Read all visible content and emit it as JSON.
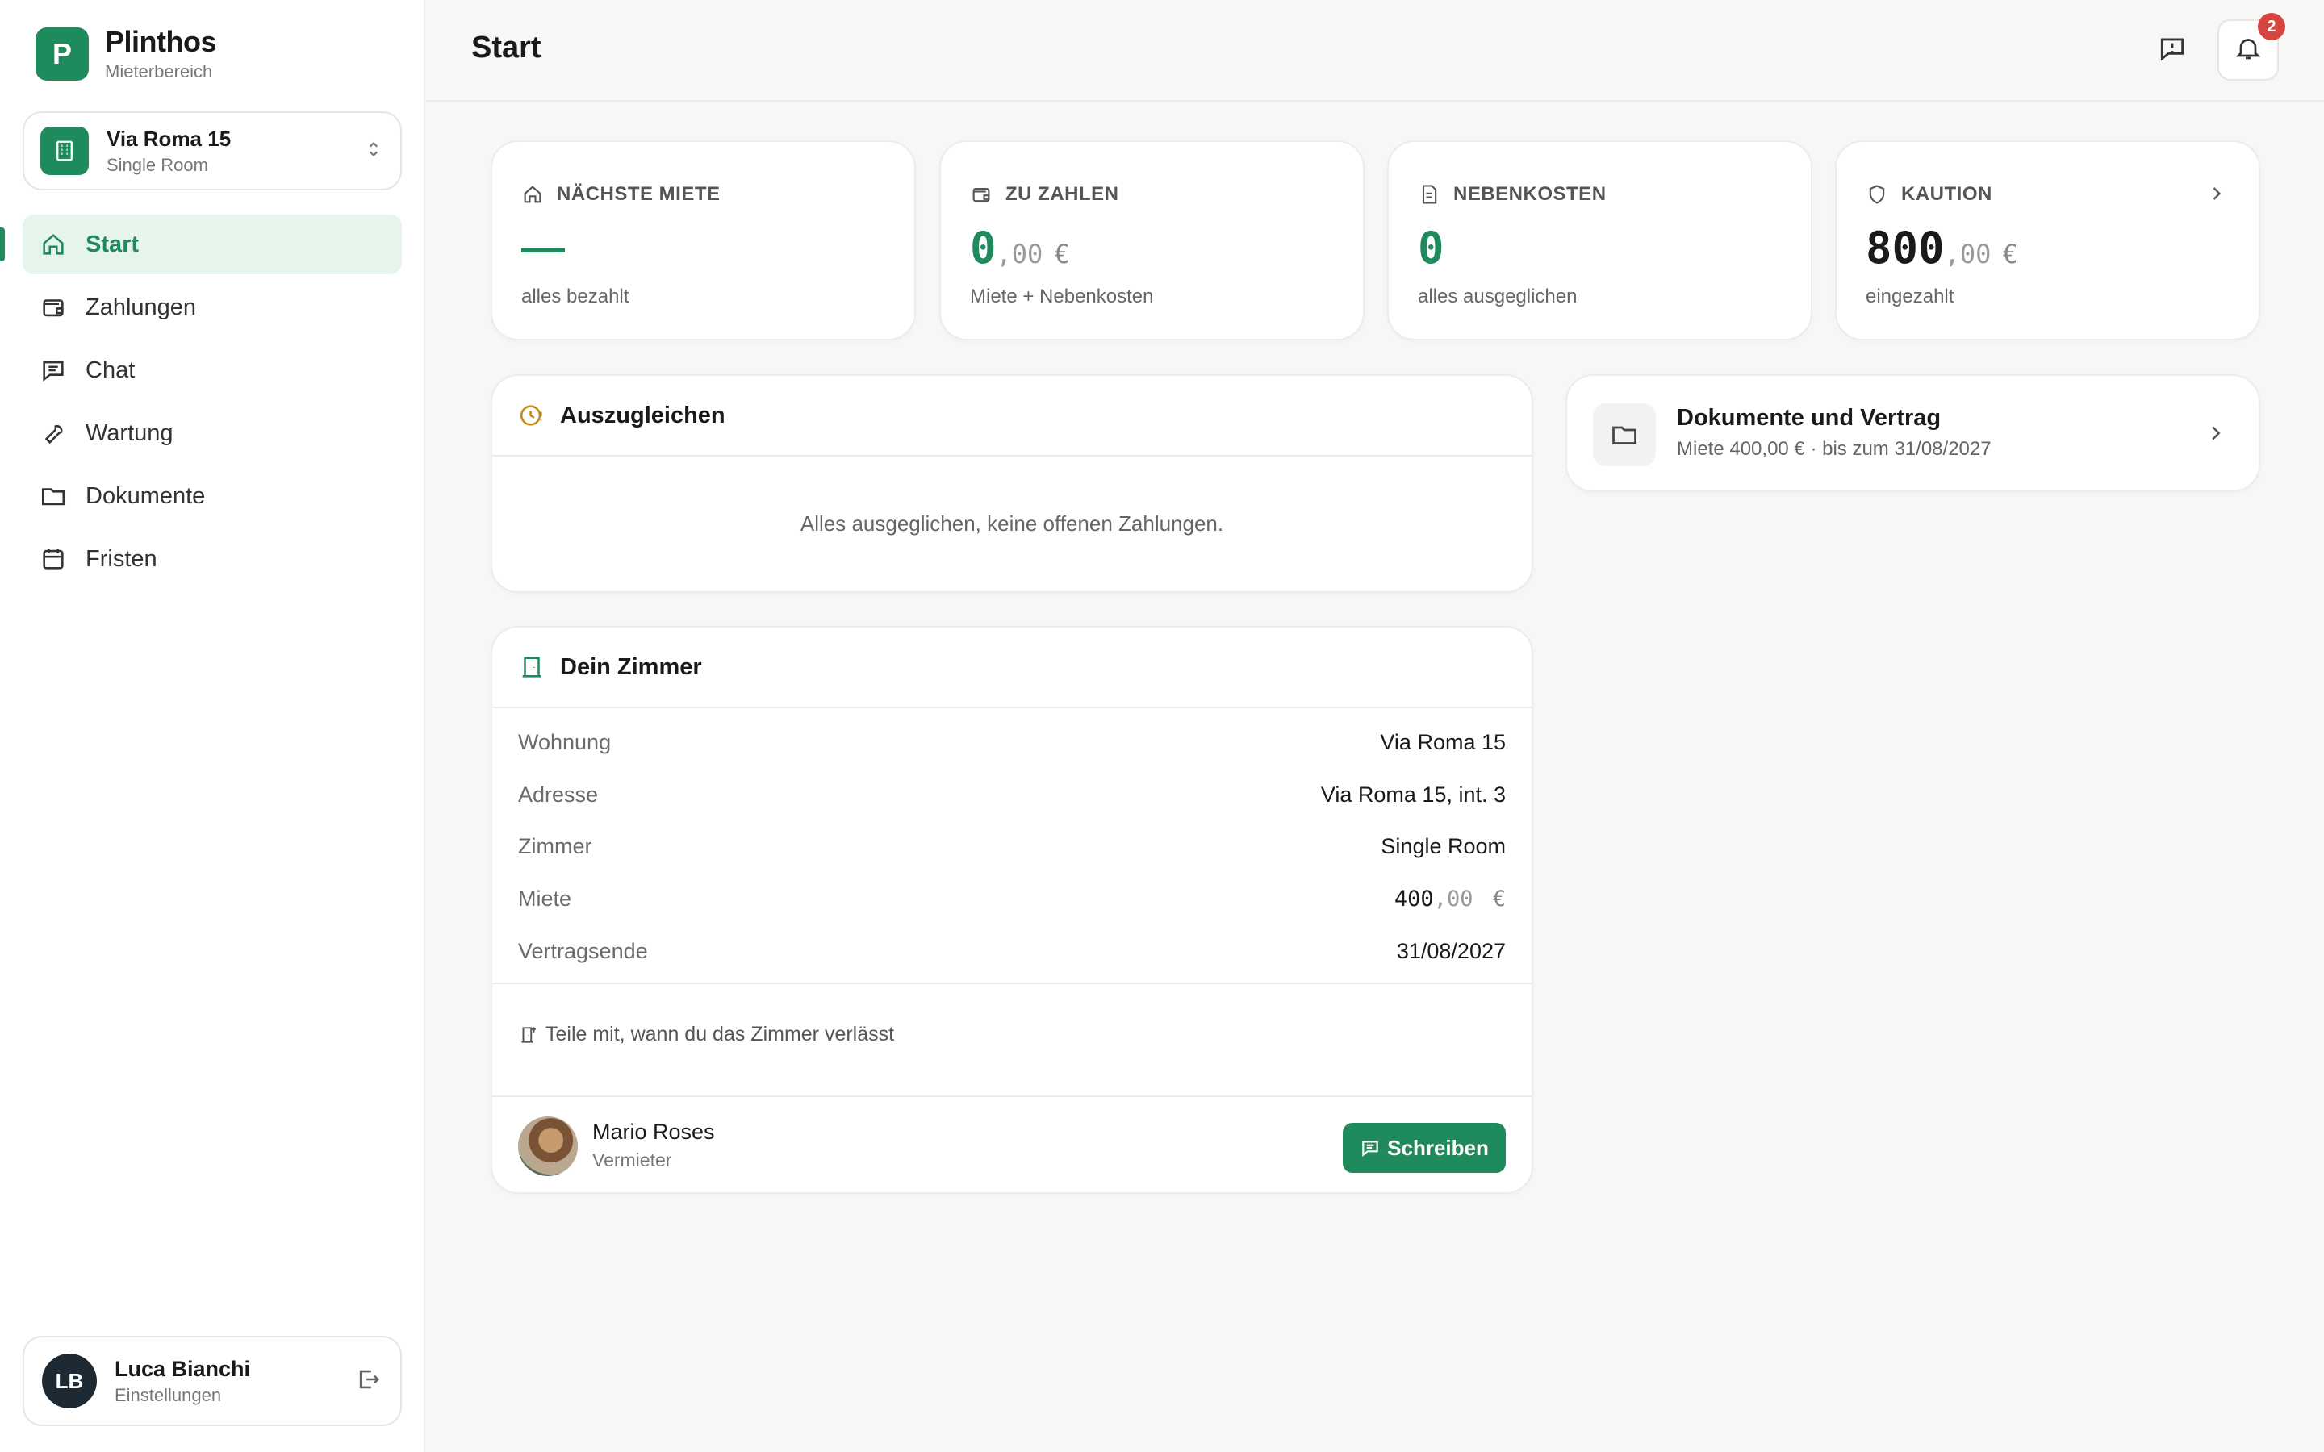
{
  "brand": {
    "initial": "P",
    "name": "Plinthos",
    "subtitle": "Mieterbereich"
  },
  "property": {
    "name": "Via Roma 15",
    "room": "Single Room"
  },
  "nav": [
    {
      "label": "Start",
      "icon": "home-icon",
      "active": true
    },
    {
      "label": "Zahlungen",
      "icon": "wallet-icon"
    },
    {
      "label": "Chat",
      "icon": "chat-icon"
    },
    {
      "label": "Wartung",
      "icon": "wrench-icon"
    },
    {
      "label": "Dokumente",
      "icon": "folder-icon"
    },
    {
      "label": "Fristen",
      "icon": "calendar-icon"
    }
  ],
  "user": {
    "initials": "LB",
    "name": "Luca Bianchi",
    "sub": "Einstellungen"
  },
  "header": {
    "title": "Start",
    "notification_count": "2"
  },
  "stats": [
    {
      "label": "NÄCHSTE MIETE",
      "value": "—",
      "note": "alles bezahlt",
      "icon": "home-icon"
    },
    {
      "label": "ZU ZAHLEN",
      "value": "0",
      "decimals": ",00",
      "currency": "€",
      "note": "Miete + Nebenkosten",
      "icon": "wallet-icon"
    },
    {
      "label": "NEBENKOSTEN",
      "value": "0",
      "note": "alles ausgeglichen",
      "icon": "document-icon"
    },
    {
      "label": "KAUTION",
      "value": "800",
      "decimals": ",00",
      "currency": "€",
      "note": "eingezahlt",
      "icon": "shield-icon"
    }
  ],
  "balance": {
    "title": "Auszugleichen",
    "empty_text": "Alles ausgeglichen, keine offenen Zahlungen."
  },
  "documents": {
    "title": "Dokumente und Vertrag",
    "subtitle": "Miete 400,00 € · bis zum 31/08/2027"
  },
  "room": {
    "title": "Dein Zimmer",
    "rows": [
      {
        "label": "Wohnung",
        "value": "Via Roma 15"
      },
      {
        "label": "Adresse",
        "value": "Via Roma 15, int. 3"
      },
      {
        "label": "Zimmer",
        "value": "Single Room"
      },
      {
        "label": "Miete",
        "value": "400",
        "decimals": ",00",
        "currency": "€"
      },
      {
        "label": "Vertragsende",
        "value": "31/08/2027"
      }
    ],
    "moveout_link": "Teile mit, wann du das Zimmer verlässt",
    "landlord": {
      "name": "Mario Roses",
      "role": "Vermieter"
    },
    "write_button": "Schreiben"
  },
  "colors": {
    "accent": "#1f8a5b",
    "accent_light": "#e6f5ec",
    "badge": "#d64540",
    "warning": "#c58a13"
  }
}
